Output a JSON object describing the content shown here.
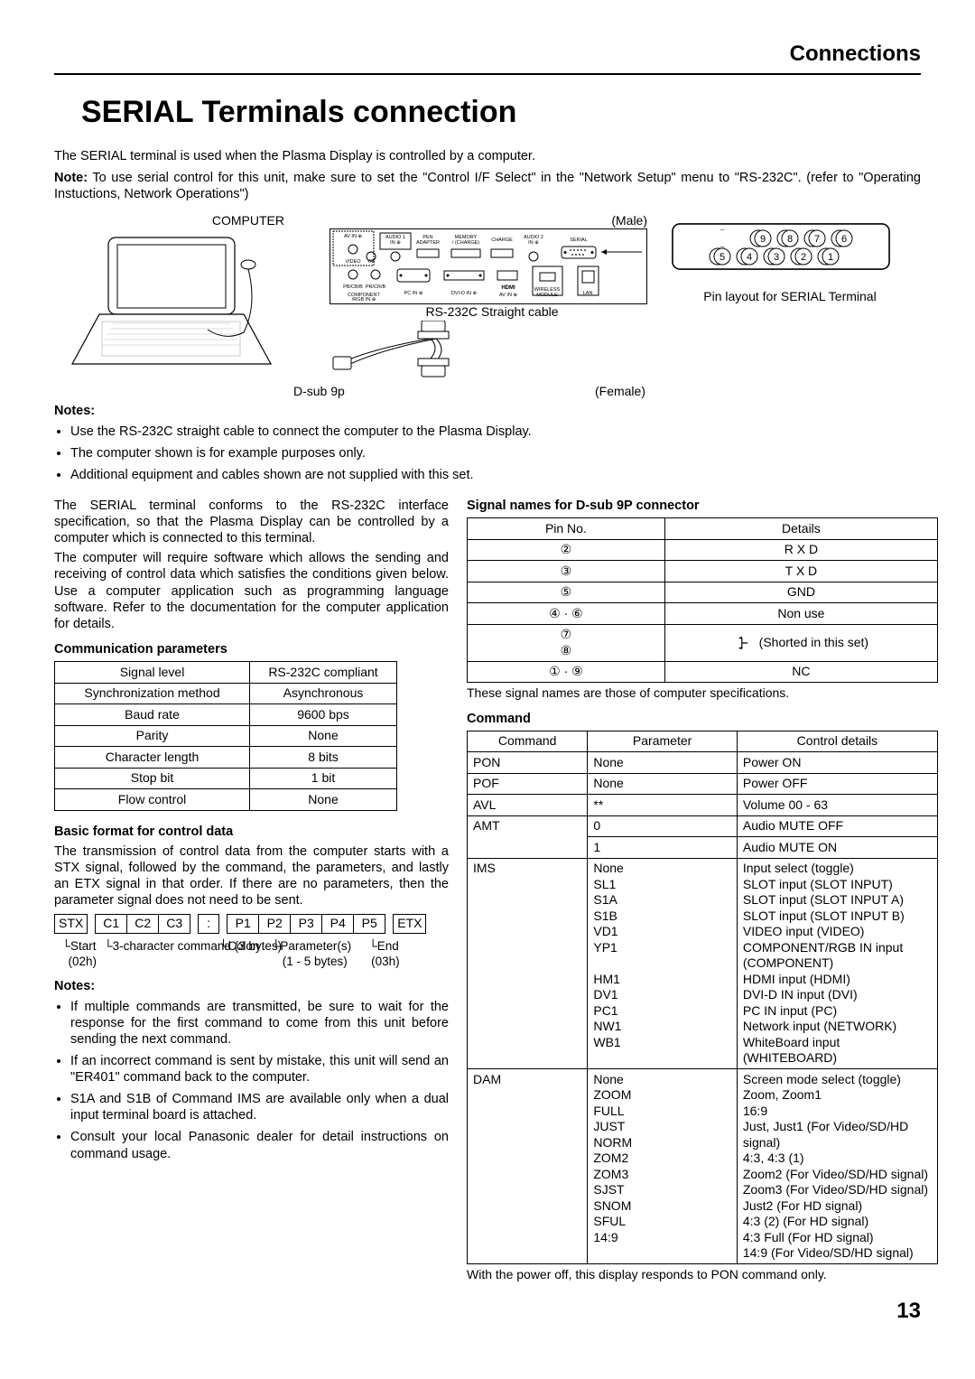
{
  "header": {
    "section": "Connections",
    "title": "SERIAL Terminals connection"
  },
  "intro": {
    "line1": "The SERIAL terminal is used when the Plasma Display is controlled by a computer.",
    "note_prefix": "Note:",
    "note_body": "To use serial control for this unit, make sure to set the \"Control I/F Select\" in the \"Network Setup\" menu to \"RS-232C\". (refer to \"Operating Instuctions, Network Operations\")"
  },
  "diagram": {
    "computer_label": "COMPUTER",
    "male_label": "(Male)",
    "cable_label": "RS-232C Straight cable",
    "female_label": "(Female)",
    "dsub_label": "D-sub 9p",
    "pin_layout_caption": "Pin layout for SERIAL Terminal",
    "port_labels": {
      "av_in": "AV IN",
      "audio1": "AUDIO 1\nIN",
      "pen": "PEN\nADAPTER",
      "memory": "MEMORY\n/ (CHARGE)",
      "charge": "CHARGE",
      "audio2": "AUDIO 2\nIN",
      "serial": "SERIAL",
      "video": "VIDEO",
      "yg": "Y/G",
      "pbcbb": "PB/CB/B  PR/CR/B",
      "component": "COMPONENT\n/RGB IN",
      "pc_in": "PC IN",
      "dvid": "DVI-D IN",
      "hdmi": "HDMI\nAV IN",
      "wireless": "WIRELESS\nMODULE",
      "lan": "LAN"
    }
  },
  "left": {
    "notes_heading": "Notes:",
    "conn_notes": [
      "Use the RS-232C straight cable to connect the computer to the Plasma Display.",
      "The computer shown is for example purposes only.",
      "Additional equipment and cables shown are not supplied with this set."
    ],
    "serial_para1": "The SERIAL terminal conforms to the RS-232C interface specification, so that the Plasma Display can be controlled by a computer which is connected to this terminal.",
    "serial_para2": "The computer will require software which allows the sending and receiving of control data which satisfies the conditions given below. Use a computer application such as programming language software. Refer to the documentation for the computer application for details.",
    "comm_heading": "Communication parameters",
    "comm_table": [
      [
        "Signal level",
        "RS-232C compliant"
      ],
      [
        "Synchronization method",
        "Asynchronous"
      ],
      [
        "Baud rate",
        "9600 bps"
      ],
      [
        "Parity",
        "None"
      ],
      [
        "Character length",
        "8 bits"
      ],
      [
        "Stop bit",
        "1 bit"
      ],
      [
        "Flow control",
        "None"
      ]
    ],
    "format_heading": "Basic format for control data",
    "format_para": "The transmission of control data from the computer starts with a STX signal, followed by the command, the parameters, and lastly an ETX signal in that order. If there are no parameters, then the parameter signal does not need to be sent.",
    "byte_cells": {
      "stx": "STX",
      "c1": "C1",
      "c2": "C2",
      "c3": "C3",
      "colon": ":",
      "p1": "P1",
      "p2": "P2",
      "p3": "P3",
      "p4": "P4",
      "p5": "P5",
      "etx": "ETX"
    },
    "byte_labels": {
      "start": "Start",
      "start_hex": "(02h)",
      "cmd": "3-character command (3 bytes)",
      "colon": "Colon",
      "params": "Parameter(s)",
      "params_bytes": "(1 - 5 bytes)",
      "end": "End",
      "end_hex": "(03h)"
    },
    "format_notes_heading": "Notes:",
    "format_notes": [
      "If multiple commands are transmitted, be sure to wait for the response for the first command to come from this unit before sending the next command.",
      "If an incorrect command is sent by mistake, this unit will send an \"ER401\" command back to the computer.",
      "S1A and S1B of Command IMS are available only when a dual input terminal board is attached.",
      "Consult your local Panasonic dealer for detail instructions on command usage."
    ]
  },
  "right": {
    "pins_heading": "Signal names for D-sub 9P connector",
    "pins_header": [
      "Pin No.",
      "Details"
    ],
    "pins_rows": [
      {
        "pins": "②",
        "detail": "R X D"
      },
      {
        "pins": "③",
        "detail": "T X D"
      },
      {
        "pins": "⑤",
        "detail": "GND"
      },
      {
        "pins": "④ · ⑥",
        "detail": "Non use"
      },
      {
        "pins": "⑦\n⑧",
        "detail": "(Shorted in this set)",
        "shorted": true
      },
      {
        "pins": "① · ⑨",
        "detail": "NC"
      }
    ],
    "pins_footnote": "These signal names are those of computer specifications.",
    "cmd_heading": "Command",
    "cmd_header": [
      "Command",
      "Parameter",
      "Control details"
    ],
    "cmd_rows": [
      {
        "cmd": "PON",
        "param": "None",
        "detail": "Power ON"
      },
      {
        "cmd": "POF",
        "param": "None",
        "detail": "Power OFF"
      },
      {
        "cmd": "AVL",
        "param": "**",
        "detail": "Volume 00 - 63"
      },
      {
        "cmd": "AMT",
        "sub": [
          {
            "param": "0",
            "detail": "Audio MUTE OFF"
          },
          {
            "param": "1",
            "detail": "Audio MUTE ON"
          }
        ]
      },
      {
        "cmd": "IMS",
        "param": "None\nSL1\nS1A\nS1B\nVD1\nYP1\n\nHM1\nDV1\nPC1\nNW1\nWB1",
        "detail": "Input select (toggle)\nSLOT input (SLOT INPUT)\nSLOT input (SLOT INPUT A)\nSLOT input (SLOT INPUT B)\nVIDEO input (VIDEO)\nCOMPONENT/RGB IN input (COMPONENT)\nHDMI input (HDMI)\nDVI-D IN input (DVI)\nPC IN input (PC)\nNetwork input (NETWORK)\nWhiteBoard input (WHITEBOARD)"
      },
      {
        "cmd": "DAM",
        "param": "None\nZOOM\nFULL\nJUST\nNORM\nZOM2\nZOM3\nSJST\nSNOM\nSFUL\n14:9",
        "detail": "Screen mode select (toggle)\nZoom, Zoom1\n16:9\nJust, Just1 (For Video/SD/HD signal)\n4:3, 4:3 (1)\nZoom2 (For Video/SD/HD signal)\nZoom3 (For Video/SD/HD signal)\nJust2 (For HD signal)\n4:3 (2) (For HD signal)\n4:3 Full (For HD signal)\n14:9 (For Video/SD/HD signal)"
      }
    ],
    "cmd_footnote": "With the power off, this display responds to PON command only."
  },
  "page_number": "13"
}
